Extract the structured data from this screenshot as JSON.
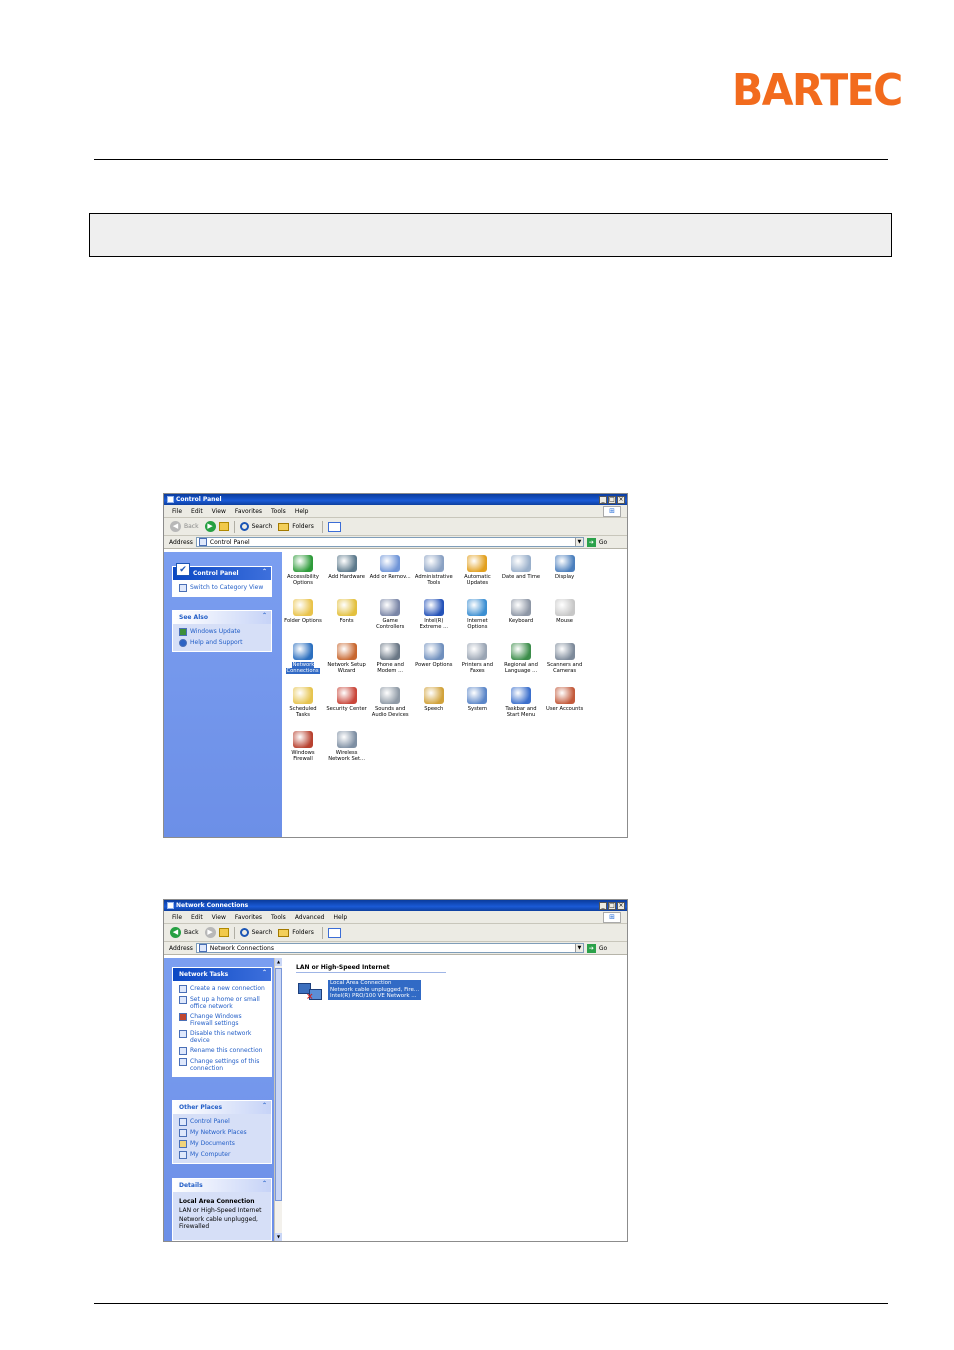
{
  "header": {
    "logo": "BARTEC"
  },
  "control_panel": {
    "title": "Control Panel",
    "menu": [
      "File",
      "Edit",
      "View",
      "Favorites",
      "Tools",
      "Help"
    ],
    "toolbar": {
      "back": "Back",
      "search": "Search",
      "folders": "Folders"
    },
    "address": {
      "label": "Address",
      "value": "Control Panel",
      "go": "Go"
    },
    "sidebar": {
      "panel_title": "Control Panel",
      "switch_link": "Switch to Category View",
      "see_also_title": "See Also",
      "see_also": [
        "Windows Update",
        "Help and Support"
      ]
    },
    "icons": [
      {
        "label": "Accessibility Options",
        "color": "#2e9b3a"
      },
      {
        "label": "Add Hardware",
        "color": "#5d7a8c"
      },
      {
        "label": "Add or Remov...",
        "color": "#6f95d8"
      },
      {
        "label": "Administrative Tools",
        "color": "#8aa1c3"
      },
      {
        "label": "Automatic Updates",
        "color": "#e2a01f"
      },
      {
        "label": "Date and Time",
        "color": "#9ab0cb"
      },
      {
        "label": "Display",
        "color": "#4b7fbd"
      },
      {
        "label": "Folder Options",
        "color": "#e9c34a"
      },
      {
        "label": "Fonts",
        "color": "#e3c03e"
      },
      {
        "label": "Game Controllers",
        "color": "#7a86a7"
      },
      {
        "label": "Intel(R) Extreme ...",
        "color": "#2452b8"
      },
      {
        "label": "Internet Options",
        "color": "#3c8fd2"
      },
      {
        "label": "Keyboard",
        "color": "#8e97a6"
      },
      {
        "label": "Mouse",
        "color": "#c7c7c7"
      },
      {
        "label": "Network Connections",
        "color": "#2b6fbf",
        "selected": true
      },
      {
        "label": "Network Setup Wizard",
        "color": "#c8672f"
      },
      {
        "label": "Phone and Modem ...",
        "color": "#6a7785"
      },
      {
        "label": "Power Options",
        "color": "#6f8fbd"
      },
      {
        "label": "Printers and Faxes",
        "color": "#9aa5b4"
      },
      {
        "label": "Regional and Language ...",
        "color": "#3c8d4a"
      },
      {
        "label": "Scanners and Cameras",
        "color": "#7d8a9a"
      },
      {
        "label": "Scheduled Tasks",
        "color": "#e6c44f"
      },
      {
        "label": "Security Center",
        "color": "#c9463a"
      },
      {
        "label": "Sounds and Audio Devices",
        "color": "#8f9aa6"
      },
      {
        "label": "Speech",
        "color": "#d1a23a"
      },
      {
        "label": "System",
        "color": "#5b86c8"
      },
      {
        "label": "Taskbar and Start Menu",
        "color": "#3b6fcc"
      },
      {
        "label": "User Accounts",
        "color": "#c35a3b"
      },
      {
        "label": "Windows Firewall",
        "color": "#b8412f"
      },
      {
        "label": "Wireless Network Set...",
        "color": "#7e8fa3"
      }
    ]
  },
  "network_connections": {
    "title": "Network Connections",
    "menu": [
      "File",
      "Edit",
      "View",
      "Favorites",
      "Tools",
      "Advanced",
      "Help"
    ],
    "toolbar": {
      "back": "Back",
      "search": "Search",
      "folders": "Folders"
    },
    "address": {
      "label": "Address",
      "value": "Network Connections",
      "go": "Go"
    },
    "network_tasks": {
      "title": "Network Tasks",
      "items": [
        "Create a new connection",
        "Set up a home or small office network",
        "Change Windows Firewall settings",
        "Disable this network device",
        "Rename this connection",
        "Change settings of this connection"
      ]
    },
    "other_places": {
      "title": "Other Places",
      "items": [
        "Control Panel",
        "My Network Places",
        "My Documents",
        "My Computer"
      ]
    },
    "details": {
      "title": "Details",
      "name": "Local Area Connection",
      "type": "LAN or High-Speed Internet",
      "status": "Network cable unplugged, Firewalled"
    },
    "group_heading": "LAN or High-Speed Internet",
    "connection": {
      "name": "Local Area Connection",
      "status": "Network cable unplugged, Fire...",
      "device": "Intel(R) PRO/100 VE Network ..."
    }
  }
}
